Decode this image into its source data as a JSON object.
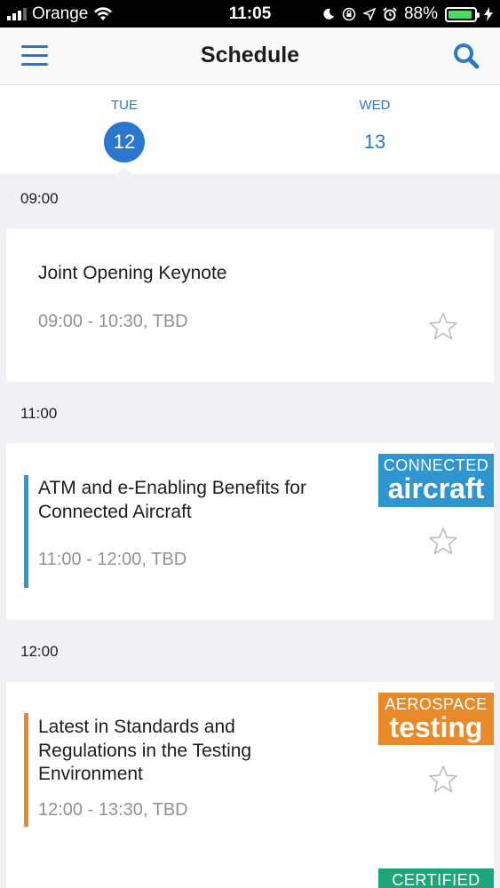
{
  "status_bar": {
    "carrier": "Orange",
    "time": "11:05",
    "battery": "88%",
    "battery_level": 0.88
  },
  "header": {
    "title": "Schedule",
    "menu_icon": "hamburger-menu-icon",
    "search_icon": "search-icon"
  },
  "days": [
    {
      "dow": "TUE",
      "date": "12",
      "active": true
    },
    {
      "dow": "WED",
      "date": "13",
      "active": false
    }
  ],
  "schedule": [
    {
      "time": "09:00",
      "session": {
        "title_lines": [
          "Joint Opening Keynote"
        ],
        "meta": "09:00 - 10:30, TBD",
        "accent": null,
        "badge": null
      }
    },
    {
      "time": "11:00",
      "session": {
        "title_lines": [
          "ATM and e-Enabling Benefits for",
          "Connected Aircraft"
        ],
        "meta": "11:00 - 12:00, TBD",
        "accent": "#2f95cf",
        "badge": {
          "small": "CONNECTED",
          "big": "aircraft",
          "color": "#2f95cf"
        }
      }
    },
    {
      "time": "12:00",
      "session": {
        "title_lines": [
          "Latest in Standards and",
          "Regulations in the Testing",
          "Environment"
        ],
        "meta": "12:00 - 13:30, TBD",
        "accent": "#e8892a",
        "badge": {
          "small": "AEROSPACE",
          "big": "testing",
          "color": "#e8892a"
        }
      }
    }
  ],
  "partial_badge": {
    "small": "CERTIFIED",
    "color": "#1ea57a"
  }
}
